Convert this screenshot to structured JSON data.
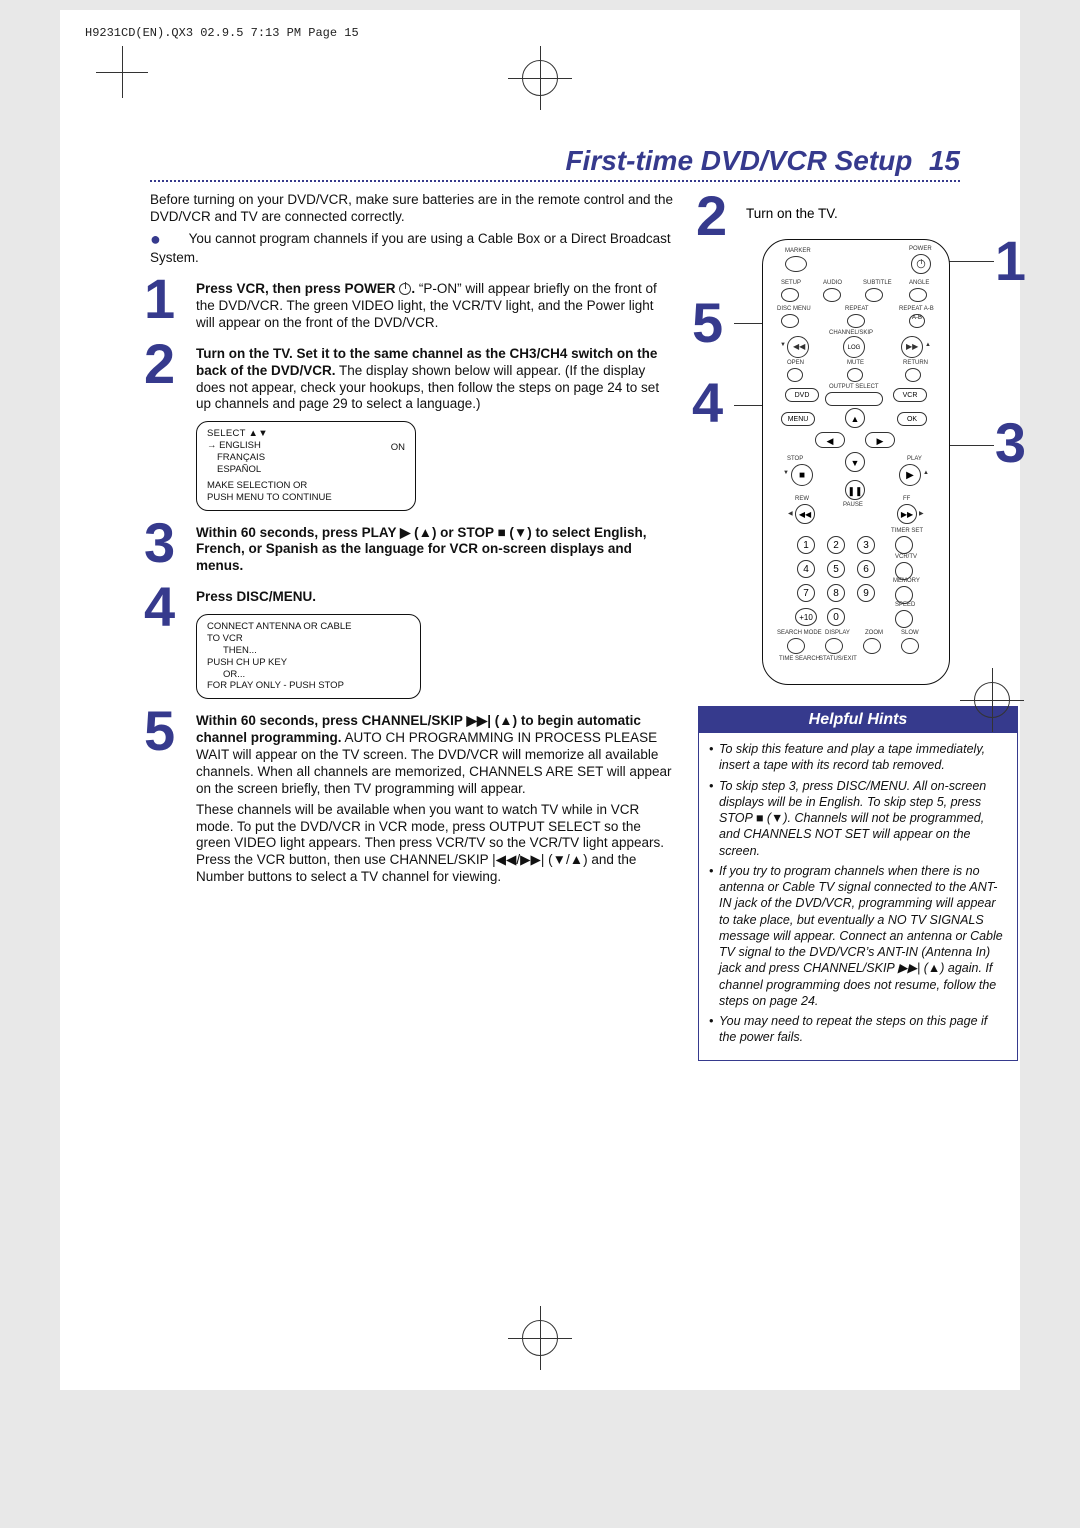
{
  "header_tag": "H9231CD(EN).QX3  02.9.5 7:13 PM  Page 15",
  "page_title": "First-time DVD/VCR Setup",
  "page_number": "15",
  "intro": {
    "line1": "Before turning on your DVD/VCR, make sure batteries are in the remote control and the DVD/VCR and TV are connected correctly.",
    "bullet": "You cannot program channels if you are using a Cable Box or a Direct Broadcast System."
  },
  "steps": [
    {
      "n": "1",
      "bold": "Press VCR, then press POWER",
      "body": "“P-ON” will appear briefly on the front of the DVD/VCR. The green VIDEO light, the VCR/TV light, and the Power light will appear on the front of the DVD/VCR.",
      "suffix_after_icon": "."
    },
    {
      "n": "2",
      "bold": "Turn on the TV. Set it to the same channel as the CH3/CH4 switch on the back of the DVD/VCR.",
      "body": " The display shown below will appear. (If the display does not appear, check your hookups, then follow the steps on page 24 to set up channels and page 29 to select a language.)"
    },
    {
      "n": "3",
      "bold": "Within 60 seconds, press PLAY ▶ (▲) or STOP ■ (▼) to select English, French, or Spanish as the language for VCR on-screen displays and menus.",
      "body": ""
    },
    {
      "n": "4",
      "bold": "Press DISC/MENU.",
      "body": ""
    },
    {
      "n": "5",
      "bold": "Within 60 seconds, press CHANNEL/SKIP ▶▶| (▲) to begin automatic channel programming.",
      "body": " AUTO CH PROGRAMMING IN PROCESS PLEASE WAIT will appear on the TV screen. The DVD/VCR will memorize all available channels. When all channels are memorized, CHANNELS ARE SET will appear on the screen briefly, then TV programming will appear.",
      "body2": "These channels will be available when you want to watch TV while in VCR mode. To put the DVD/VCR in VCR mode, press OUTPUT SELECT so the green VIDEO light appears. Then press VCR/TV so the VCR/TV light appears. Press the VCR button, then use CHANNEL/SKIP |◀◀/▶▶| (▼/▲) and the Number buttons to select a TV channel for viewing."
    }
  ],
  "screen1": {
    "title": "SELECT ▲▼",
    "items": [
      "→ ENGLISH",
      "   FRANÇAIS",
      "   ESPAÑOL"
    ],
    "right": "ON",
    "footer1": "MAKE SELECTION OR",
    "footer2": "PUSH MENU TO CONTINUE"
  },
  "screen2": {
    "l1": "CONNECT ANTENNA OR CABLE",
    "l2": "TO VCR",
    "l3": "THEN...",
    "l4": "PUSH CH UP KEY",
    "l5": "OR...",
    "l6": "FOR PLAY ONLY - PUSH STOP"
  },
  "tv_step": {
    "n": "2",
    "text": "Turn on the TV."
  },
  "remote_labels": {
    "power": "POWER",
    "marker": "MARKER",
    "setup": "SETUP",
    "audio": "AUDIO",
    "subtitle": "SUBTITLE",
    "angle": "ANGLE",
    "discmenu": "DISC MENU",
    "repeat": "REPEAT",
    "repeat_ab": "REPEAT A-B",
    "ch_skip": "CHANNEL/SKIP",
    "open": "OPEN",
    "mute": "MUTE",
    "return": "RETURN",
    "output": "OUTPUT SELECT",
    "dvd": "DVD",
    "vcr": "VCR",
    "menu": "MENU",
    "ok": "OK",
    "stop": "STOP",
    "play": "PLAY",
    "pause": "PAUSE",
    "rew": "REW",
    "ff": "FF",
    "timerset": "TIMER SET",
    "vcrtv": "VCR/TV",
    "memory": "MEMORY",
    "speed": "SPEED",
    "searchmode": "SEARCH MODE",
    "display": "DISPLAY",
    "zoom": "ZOOM",
    "slow": "SLOW",
    "timesearch": "TIME SEARCH",
    "status": "STATUS/EXIT",
    "plus10": "+10",
    "nums": [
      "1",
      "2",
      "3",
      "4",
      "5",
      "6",
      "7",
      "8",
      "9",
      "0"
    ]
  },
  "callouts": {
    "c1": "1",
    "c2": "2",
    "c3": "3",
    "c4": "4",
    "c5": "5"
  },
  "hints": {
    "title": "Helpful Hints",
    "items": [
      "To skip this feature and play a tape immediately, insert a tape with its record tab removed.",
      "To skip step 3, press DISC/MENU. All on-screen displays will be in English. To skip step 5, press STOP ■ (▼). Channels will not be programmed, and CHANNELS NOT SET will appear on the screen.",
      "If you try to program channels when there is no antenna or Cable TV signal connected to the ANT-IN jack of the DVD/VCR, programming will appear to take place, but eventually a NO TV SIGNALS message will appear. Connect an antenna or Cable TV signal to the DVD/VCR’s ANT-IN (Antenna In) jack and press CHANNEL/SKIP ▶▶| (▲) again. If channel programming does not resume, follow the steps on page 24.",
      "You may need to repeat the steps on this page if the power fails."
    ]
  }
}
